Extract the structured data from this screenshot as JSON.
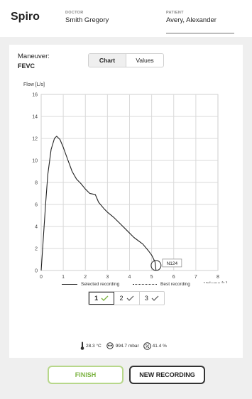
{
  "header": {
    "app_title": "Spiro",
    "doctor_label": "DOCTOR",
    "doctor_name": "Smith Gregory",
    "patient_label": "PATIENT",
    "patient_name": "Avery, Alexander"
  },
  "maneuver": {
    "label": "Maneuver:",
    "value": "FEVC"
  },
  "view_tabs": {
    "chart": "Chart",
    "values": "Values",
    "active": "Chart"
  },
  "chart_data": {
    "type": "line",
    "ylabel": "Flow [L/s]",
    "xlabel": "Volume [L]",
    "xlim": [
      0,
      8
    ],
    "ylim": [
      0,
      16
    ],
    "x_ticks": [
      "0",
      "1",
      "2",
      "3",
      "4",
      "5",
      "6",
      "7",
      "8"
    ],
    "y_ticks": [
      "0",
      "2",
      "4",
      "6",
      "8",
      "10",
      "12",
      "14",
      "16"
    ],
    "grid": true,
    "series": [
      {
        "name": "Selected recording",
        "style": "solid",
        "points": [
          [
            0.0,
            0.0
          ],
          [
            0.1,
            3.0
          ],
          [
            0.2,
            6.0
          ],
          [
            0.3,
            8.7
          ],
          [
            0.45,
            11.0
          ],
          [
            0.6,
            12.0
          ],
          [
            0.7,
            12.2
          ],
          [
            0.85,
            11.9
          ],
          [
            1.0,
            11.2
          ],
          [
            1.2,
            10.1
          ],
          [
            1.4,
            9.0
          ],
          [
            1.6,
            8.3
          ],
          [
            1.8,
            7.9
          ],
          [
            2.0,
            7.4
          ],
          [
            2.2,
            7.0
          ],
          [
            2.45,
            6.9
          ],
          [
            2.6,
            6.2
          ],
          [
            2.85,
            5.6
          ],
          [
            3.0,
            5.3
          ],
          [
            3.3,
            4.8
          ],
          [
            3.6,
            4.2
          ],
          [
            3.9,
            3.6
          ],
          [
            4.2,
            3.0
          ],
          [
            4.6,
            2.4
          ],
          [
            4.85,
            1.8
          ],
          [
            5.0,
            1.4
          ],
          [
            5.15,
            0.8
          ],
          [
            5.2,
            0.0
          ]
        ]
      }
    ],
    "marker": {
      "label": "N124",
      "x": 5.2,
      "y": 0.2
    },
    "legend": [
      {
        "name": "Selected recording",
        "style": "solid"
      },
      {
        "name": "Best recording",
        "style": "dotted"
      }
    ],
    "legend_position": "bottom"
  },
  "trials": [
    {
      "label": "1",
      "checked": true,
      "active": true
    },
    {
      "label": "2",
      "checked": true,
      "active": false
    },
    {
      "label": "3",
      "checked": true,
      "active": false
    }
  ],
  "environment": {
    "temperature": "28.3 °C",
    "pressure": "994.7 mbar",
    "humidity": "41.4 %"
  },
  "buttons": {
    "finish": "FINISH",
    "new_recording": "NEW RECORDING"
  },
  "colors": {
    "accent_green": "#7cb342",
    "finish_border": "#b7d78a",
    "dark": "#333333",
    "check_active": "#7cb342",
    "check_inactive": "#555555"
  },
  "icons": [
    "thermometer-icon",
    "pressure-gauge-icon",
    "humidity-icon",
    "check-icon"
  ]
}
